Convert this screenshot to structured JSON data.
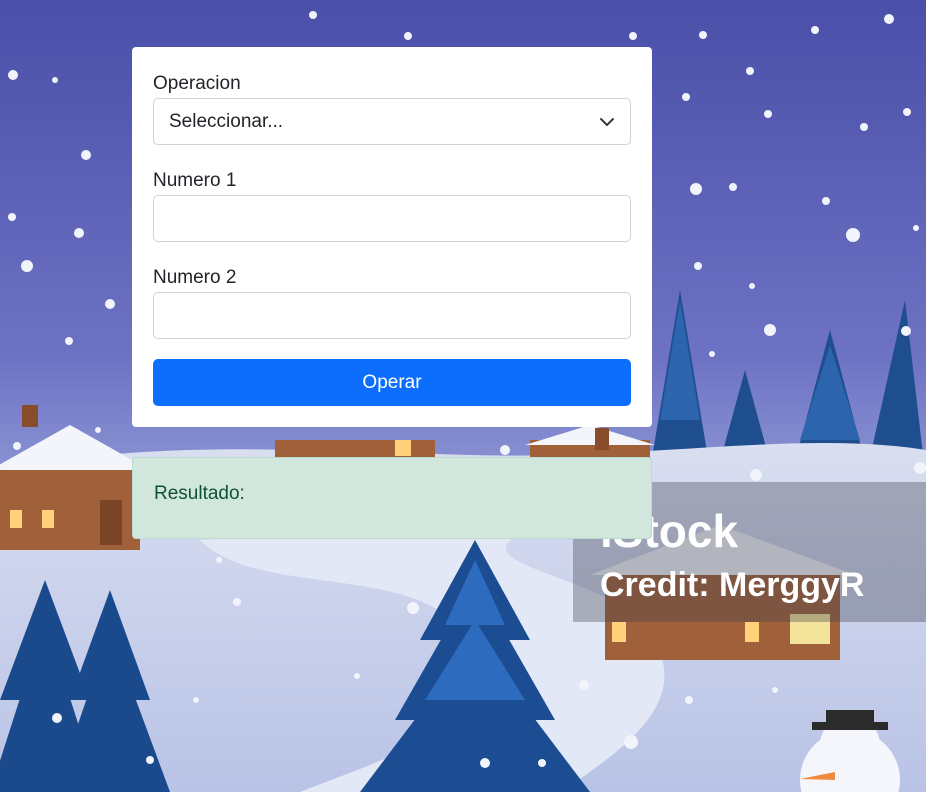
{
  "form": {
    "operation_label": "Operacion",
    "operation_selected": "Seleccionar...",
    "number1_label": "Numero 1",
    "number1_value": "",
    "number2_label": "Numero 2",
    "number2_value": "",
    "submit_label": "Operar"
  },
  "result": {
    "label": "Resultado:"
  },
  "background": {
    "watermark_brand": "iStock",
    "watermark_credit": "Credit: MerggyR"
  },
  "colors": {
    "primary": "#0d6efd",
    "result_bg": "#d1e7dd",
    "result_text": "#0f5132",
    "sky_top": "#4a4fa8",
    "snow": "#e8ecf6"
  },
  "icons": {
    "select_chevron": "chevron-down-icon"
  }
}
